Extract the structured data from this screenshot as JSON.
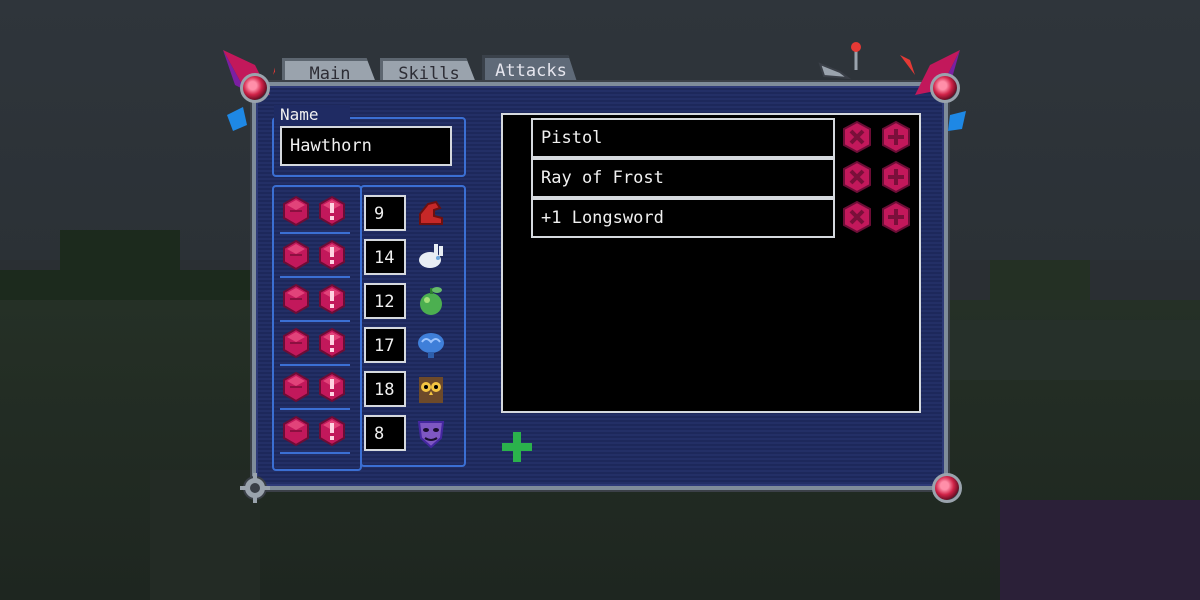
{
  "tabs": [
    {
      "label": "Main",
      "active": false
    },
    {
      "label": "Skills",
      "active": false
    },
    {
      "label": "Attacks",
      "active": true
    }
  ],
  "name_field": {
    "label": "Name",
    "value": "Hawthorn"
  },
  "stats": [
    {
      "value": "9",
      "icon": "strength-arm-icon"
    },
    {
      "value": "14",
      "icon": "dexterity-rabbit-icon"
    },
    {
      "value": "12",
      "icon": "constitution-apple-icon"
    },
    {
      "value": "17",
      "icon": "intelligence-brain-icon"
    },
    {
      "value": "18",
      "icon": "wisdom-owl-icon"
    },
    {
      "value": "8",
      "icon": "charisma-mask-icon"
    }
  ],
  "attacks": [
    {
      "name": "Pistol"
    },
    {
      "name": "Ray of Frost"
    },
    {
      "name": "+1 Longsword"
    }
  ],
  "colors": {
    "panel_bg": "#1f2b63",
    "accent_blue": "#3b6fd3",
    "gem_magenta": "#c2185b",
    "add_green": "#2bb24c",
    "frame_grey": "#7f8c9a"
  }
}
